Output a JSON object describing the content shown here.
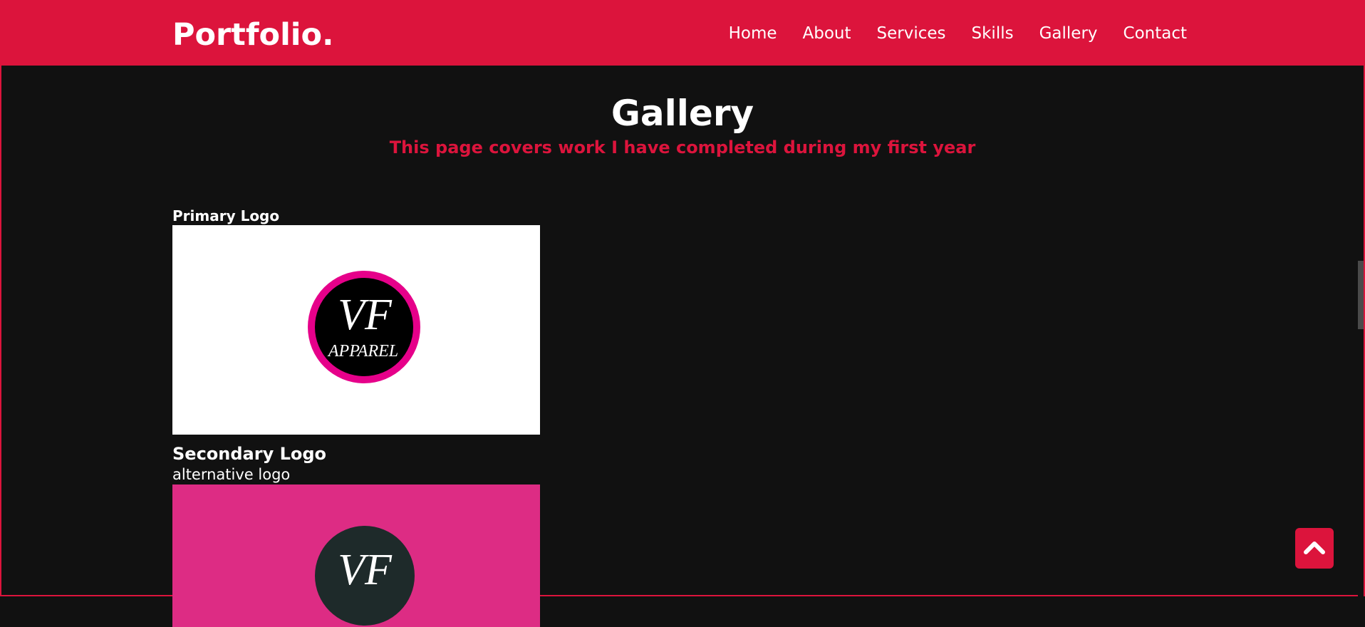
{
  "header": {
    "logo": "Portfolio.",
    "nav": [
      "Home",
      "About",
      "Services",
      "Skills",
      "Gallery",
      "Contact"
    ]
  },
  "page": {
    "title": "Gallery",
    "subtitle": "This page covers work I have completed during my first year"
  },
  "gallery": {
    "items": [
      {
        "title": "Primary Logo",
        "image": {
          "monogram": "VF",
          "text": "APPAREL",
          "ring_color": "#e6008a",
          "bg": "#ffffff"
        }
      },
      {
        "title": "Secondary Logo",
        "description": "alternative logo",
        "image": {
          "monogram": "VF",
          "bg": "#dd2c84",
          "circle_color": "#1e2a2a"
        }
      }
    ]
  },
  "scroll_top": {
    "icon": "chevron-up-icon"
  },
  "colors": {
    "accent": "#dc143c",
    "background": "#111111",
    "text": "#ffffff"
  }
}
